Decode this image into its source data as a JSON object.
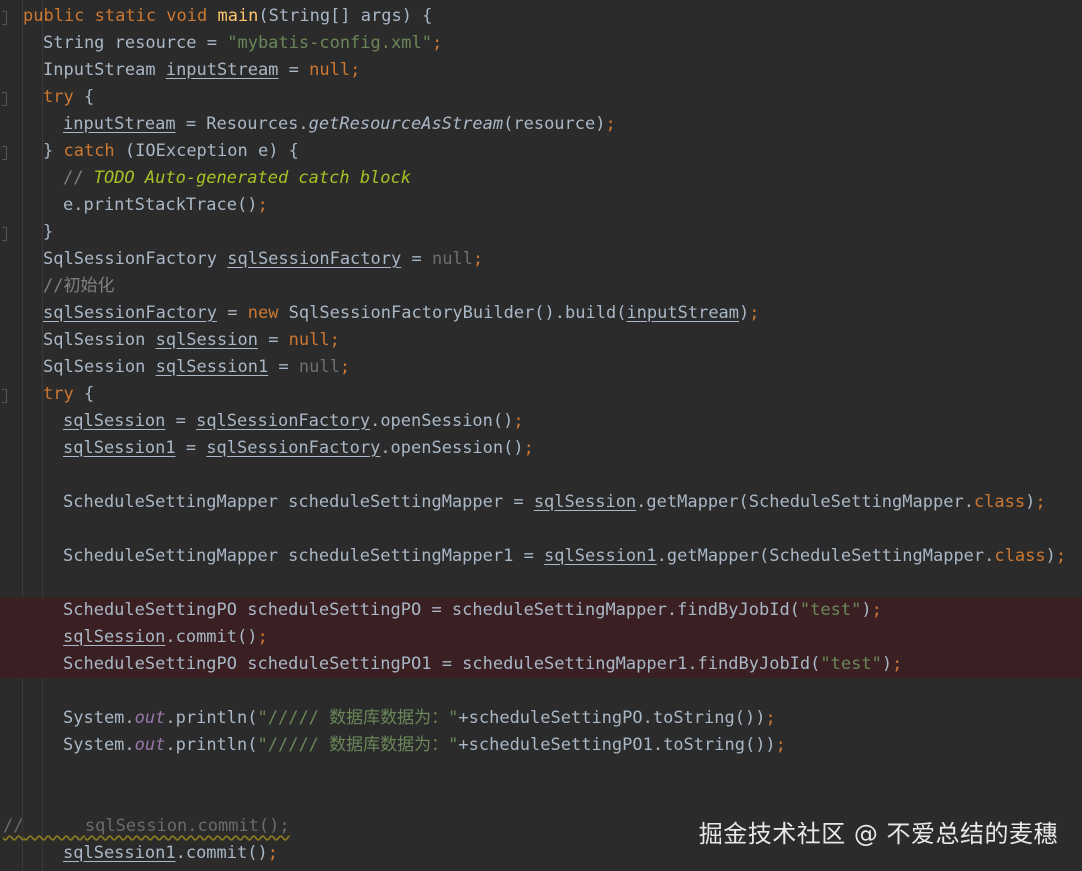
{
  "code": {
    "l1": {
      "kw1": "public static void ",
      "method": "main",
      "rest": "(String[] args) {"
    },
    "l2": {
      "a": "String resource = ",
      "str": "\"mybatis-config.xml\"",
      "semi": ";"
    },
    "l3": {
      "a": "InputStream ",
      "var": "inputStream",
      "b": " = ",
      "nul": "null",
      "semi": ";"
    },
    "l4": {
      "kw": "try",
      "b": " {"
    },
    "l5": {
      "var": "inputStream",
      "b": " = Resources.",
      "m": "getResourceAsStream",
      "c": "(resource)",
      "semi": ";"
    },
    "l6": {
      "a": "} ",
      "kw": "catch",
      "b": " (IOException e) {"
    },
    "l7": {
      "c": "// ",
      "todo": "TODO Auto-generated catch block"
    },
    "l8": {
      "a": "e.printStackTrace()",
      "semi": ";"
    },
    "l9": {
      "a": "}"
    },
    "l10": {
      "a": "SqlSessionFactory ",
      "var": "sqlSessionFactory",
      "b": " = ",
      "nul": "null",
      "semi": ";"
    },
    "l11": {
      "c": "//初始化"
    },
    "l12": {
      "var": "sqlSessionFactory",
      "b": " = ",
      "kw": "new",
      "c": " SqlSessionFactoryBuilder().build(",
      "var2": "inputStream",
      "d": ")",
      "semi": ";"
    },
    "l13": {
      "a": "SqlSession ",
      "var": "sqlSession",
      "b": " = ",
      "nul": "null",
      "semi": ";"
    },
    "l14": {
      "a": "SqlSession ",
      "var": "sqlSession1",
      "b": " = ",
      "nul": "null",
      "semi": ";"
    },
    "l15": {
      "kw": "try",
      "b": " {"
    },
    "l16": {
      "var": "sqlSession",
      "b": " = ",
      "var2": "sqlSessionFactory",
      "c": ".openSession()",
      "semi": ";"
    },
    "l17": {
      "var": "sqlSession1",
      "b": " = ",
      "var2": "sqlSessionFactory",
      "c": ".openSession()",
      "semi": ";"
    },
    "l18": {
      "a": "ScheduleSettingMapper scheduleSettingMapper = ",
      "var": "sqlSession",
      "b": ".getMapper(ScheduleSettingMapper.",
      "kw": "class",
      "c": ")",
      "semi": ";"
    },
    "l19": {
      "a": "ScheduleSettingMapper scheduleSettingMapper1 = ",
      "var": "sqlSession1",
      "b": ".getMapper(ScheduleSettingMapper.",
      "kw": "class",
      "c": ")",
      "semi": ";"
    },
    "l20": {
      "a": "ScheduleSettingPO scheduleSettingPO = scheduleSettingMapper.findByJobId(",
      "str": "\"test\"",
      "b": ")",
      "semi": ";"
    },
    "l21": {
      "var": "sqlSession",
      "b": ".commit()",
      "semi": ";"
    },
    "l22": {
      "a": "ScheduleSettingPO scheduleSettingPO1 = scheduleSettingMapper1.findByJobId(",
      "str": "\"test\"",
      "b": ")",
      "semi": ";"
    },
    "l23": {
      "a": "System.",
      "out": "out",
      "b": ".println(",
      "str": "\"///// 数据库数据为：\"",
      "c": "+scheduleSettingPO.toString())",
      "semi": ";"
    },
    "l24": {
      "a": "System.",
      "out": "out",
      "b": ".println(",
      "str": "\"///// 数据库数据为：\"",
      "c": "+scheduleSettingPO1.toString())",
      "semi": ";"
    },
    "l25": {
      "slash": "//",
      "pad": "      ",
      "rest": "sqlSession.commit();"
    },
    "l26": {
      "var": "sqlSession1",
      "b": ".commit()",
      "semi": ";"
    }
  },
  "watermark": "掘金技术社区 @ 不爱总结的麦穗",
  "colors": {
    "background": "#2b2b2b",
    "keyword": "#cc7832",
    "string": "#6a8759",
    "highlight": "#3a2022"
  }
}
